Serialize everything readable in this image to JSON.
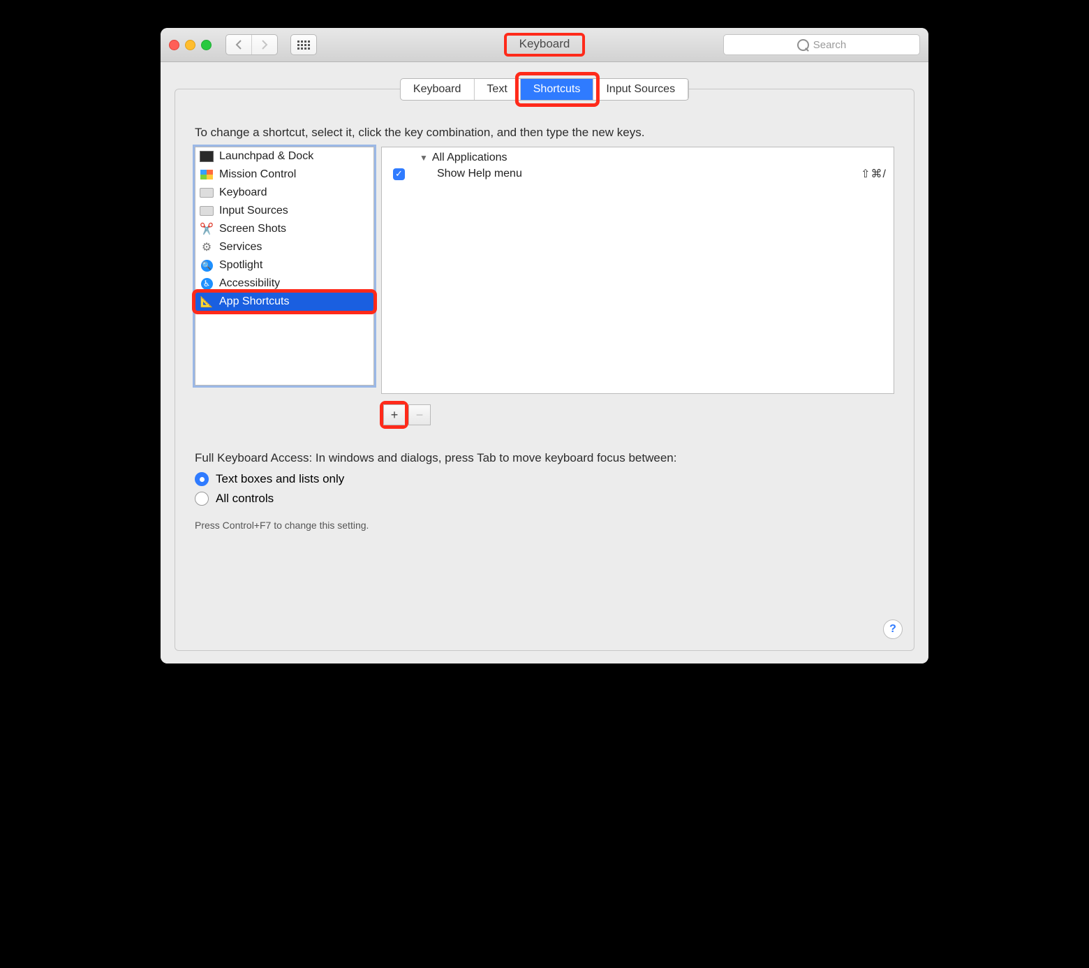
{
  "window": {
    "title": "Keyboard"
  },
  "toolbar": {
    "search_placeholder": "Search"
  },
  "tabs": {
    "items": [
      {
        "label": "Keyboard",
        "active": false
      },
      {
        "label": "Text",
        "active": false
      },
      {
        "label": "Shortcuts",
        "active": true
      },
      {
        "label": "Input Sources",
        "active": false
      }
    ]
  },
  "instructions": "To change a shortcut, select it, click the key combination, and then type the new keys.",
  "categories": {
    "items": [
      {
        "label": "Launchpad & Dock",
        "icon": "launchpad-icon"
      },
      {
        "label": "Mission Control",
        "icon": "mission-control-icon"
      },
      {
        "label": "Keyboard",
        "icon": "keyboard-icon"
      },
      {
        "label": "Input Sources",
        "icon": "keyboard-icon"
      },
      {
        "label": "Screen Shots",
        "icon": "screen-shots-icon"
      },
      {
        "label": "Services",
        "icon": "gear-icon"
      },
      {
        "label": "Spotlight",
        "icon": "spotlight-icon"
      },
      {
        "label": "Accessibility",
        "icon": "accessibility-icon"
      },
      {
        "label": "App Shortcuts",
        "icon": "app-shortcuts-icon",
        "selected": true
      }
    ]
  },
  "detail": {
    "group_label": "All Applications",
    "rows": [
      {
        "checked": true,
        "label": "Show Help menu",
        "shortcut": "⇧⌘/"
      }
    ]
  },
  "buttons": {
    "add": "+",
    "remove": "−"
  },
  "full_keyboard_access": {
    "label": "Full Keyboard Access: In windows and dialogs, press Tab to move keyboard focus between:",
    "options": [
      {
        "label": "Text boxes and lists only",
        "selected": true
      },
      {
        "label": "All controls",
        "selected": false
      }
    ],
    "hint": "Press Control+F7 to change this setting."
  },
  "help_label": "?"
}
